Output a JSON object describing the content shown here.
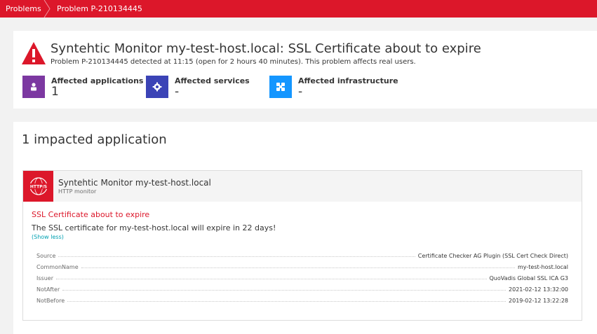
{
  "breadcrumb": {
    "items": [
      {
        "label": "Problems"
      },
      {
        "label": "Problem P-210134445"
      }
    ]
  },
  "problem": {
    "title": "Syntehtic Monitor my-test-host.local: SSL Certificate about to expire",
    "subtitle": "Problem P-210134445 detected at 11:15 (open for 2 hours 40 minutes). This problem affects real users.",
    "icon": "warning-triangle-icon",
    "color": "#dc172a"
  },
  "affected": {
    "applications": {
      "label": "Affected applications",
      "value": "1",
      "icon": "application-icon",
      "color": "#7c38a1"
    },
    "services": {
      "label": "Affected services",
      "value": "-",
      "icon": "service-gear-icon",
      "color": "#3b43b6"
    },
    "infrastructure": {
      "label": "Affected infrastructure",
      "value": "-",
      "icon": "infrastructure-icon",
      "color": "#1496ff"
    }
  },
  "impacted": {
    "title": "1 impacted application",
    "app": {
      "name": "Syntehtic Monitor my-test-host.local",
      "type": "HTTP monitor",
      "badge": "HTTP/S",
      "badge_color": "#dc172a"
    },
    "event": {
      "title": "SSL Certificate about to expire",
      "description": "The SSL certificate for my-test-host.local will expire in 22 days!",
      "toggle": "(Show less)"
    },
    "properties": [
      {
        "key": "Source",
        "value": "Certificate Checker AG Plugin (SSL Cert Check Direct)"
      },
      {
        "key": "CommonName",
        "value": "my-test-host.local"
      },
      {
        "key": "Issuer",
        "value": "QuoVadis Global SSL ICA G3"
      },
      {
        "key": "NotAfter",
        "value": "2021-02-12 13:32:00"
      },
      {
        "key": "NotBefore",
        "value": "2019-02-12 13:22:28"
      }
    ]
  }
}
